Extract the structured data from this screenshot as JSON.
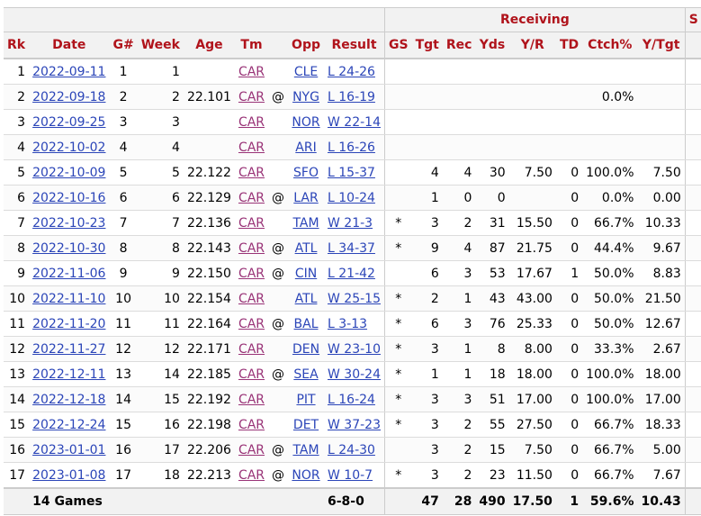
{
  "group_headers": {
    "receiving": "Receiving",
    "next": "S"
  },
  "columns": [
    "Rk",
    "Date",
    "G#",
    "Week",
    "Age",
    "Tm",
    "",
    "Opp",
    "Result",
    "GS",
    "Tgt",
    "Rec",
    "Yds",
    "Y/R",
    "TD",
    "Ctch%",
    "Y/Tgt"
  ],
  "rows": [
    {
      "rk": "1",
      "date": "2022-09-11",
      "g": "1",
      "week": "1",
      "age": "",
      "tm": "CAR",
      "at": "",
      "opp": "CLE",
      "result": "L 24-26",
      "gs": "",
      "tgt": "",
      "rec": "",
      "yds": "",
      "yr": "",
      "td": "",
      "ctch": "",
      "ytgt": ""
    },
    {
      "rk": "2",
      "date": "2022-09-18",
      "g": "2",
      "week": "2",
      "age": "22.101",
      "tm": "CAR",
      "at": "@",
      "opp": "NYG",
      "result": "L 16-19",
      "gs": "",
      "tgt": "",
      "rec": "",
      "yds": "",
      "yr": "",
      "td": "",
      "ctch": "0.0%",
      "ytgt": ""
    },
    {
      "rk": "3",
      "date": "2022-09-25",
      "g": "3",
      "week": "3",
      "age": "",
      "tm": "CAR",
      "at": "",
      "opp": "NOR",
      "result": "W 22-14",
      "gs": "",
      "tgt": "",
      "rec": "",
      "yds": "",
      "yr": "",
      "td": "",
      "ctch": "",
      "ytgt": ""
    },
    {
      "rk": "4",
      "date": "2022-10-02",
      "g": "4",
      "week": "4",
      "age": "",
      "tm": "CAR",
      "at": "",
      "opp": "ARI",
      "result": "L 16-26",
      "gs": "",
      "tgt": "",
      "rec": "",
      "yds": "",
      "yr": "",
      "td": "",
      "ctch": "",
      "ytgt": ""
    },
    {
      "rk": "5",
      "date": "2022-10-09",
      "g": "5",
      "week": "5",
      "age": "22.122",
      "tm": "CAR",
      "at": "",
      "opp": "SFO",
      "result": "L 15-37",
      "gs": "",
      "tgt": "4",
      "rec": "4",
      "yds": "30",
      "yr": "7.50",
      "td": "0",
      "ctch": "100.0%",
      "ytgt": "7.50"
    },
    {
      "rk": "6",
      "date": "2022-10-16",
      "g": "6",
      "week": "6",
      "age": "22.129",
      "tm": "CAR",
      "at": "@",
      "opp": "LAR",
      "result": "L 10-24",
      "gs": "",
      "tgt": "1",
      "rec": "0",
      "yds": "0",
      "yr": "",
      "td": "0",
      "ctch": "0.0%",
      "ytgt": "0.00"
    },
    {
      "rk": "7",
      "date": "2022-10-23",
      "g": "7",
      "week": "7",
      "age": "22.136",
      "tm": "CAR",
      "at": "",
      "opp": "TAM",
      "result": "W 21-3",
      "gs": "*",
      "tgt": "3",
      "rec": "2",
      "yds": "31",
      "yr": "15.50",
      "td": "0",
      "ctch": "66.7%",
      "ytgt": "10.33"
    },
    {
      "rk": "8",
      "date": "2022-10-30",
      "g": "8",
      "week": "8",
      "age": "22.143",
      "tm": "CAR",
      "at": "@",
      "opp": "ATL",
      "result": "L 34-37",
      "gs": "*",
      "tgt": "9",
      "rec": "4",
      "yds": "87",
      "yr": "21.75",
      "td": "0",
      "ctch": "44.4%",
      "ytgt": "9.67"
    },
    {
      "rk": "9",
      "date": "2022-11-06",
      "g": "9",
      "week": "9",
      "age": "22.150",
      "tm": "CAR",
      "at": "@",
      "opp": "CIN",
      "result": "L 21-42",
      "gs": "",
      "tgt": "6",
      "rec": "3",
      "yds": "53",
      "yr": "17.67",
      "td": "1",
      "ctch": "50.0%",
      "ytgt": "8.83"
    },
    {
      "rk": "10",
      "date": "2022-11-10",
      "g": "10",
      "week": "10",
      "age": "22.154",
      "tm": "CAR",
      "at": "",
      "opp": "ATL",
      "result": "W 25-15",
      "gs": "*",
      "tgt": "2",
      "rec": "1",
      "yds": "43",
      "yr": "43.00",
      "td": "0",
      "ctch": "50.0%",
      "ytgt": "21.50"
    },
    {
      "rk": "11",
      "date": "2022-11-20",
      "g": "11",
      "week": "11",
      "age": "22.164",
      "tm": "CAR",
      "at": "@",
      "opp": "BAL",
      "result": "L 3-13",
      "gs": "*",
      "tgt": "6",
      "rec": "3",
      "yds": "76",
      "yr": "25.33",
      "td": "0",
      "ctch": "50.0%",
      "ytgt": "12.67"
    },
    {
      "rk": "12",
      "date": "2022-11-27",
      "g": "12",
      "week": "12",
      "age": "22.171",
      "tm": "CAR",
      "at": "",
      "opp": "DEN",
      "result": "W 23-10",
      "gs": "*",
      "tgt": "3",
      "rec": "1",
      "yds": "8",
      "yr": "8.00",
      "td": "0",
      "ctch": "33.3%",
      "ytgt": "2.67"
    },
    {
      "rk": "13",
      "date": "2022-12-11",
      "g": "13",
      "week": "14",
      "age": "22.185",
      "tm": "CAR",
      "at": "@",
      "opp": "SEA",
      "result": "W 30-24",
      "gs": "*",
      "tgt": "1",
      "rec": "1",
      "yds": "18",
      "yr": "18.00",
      "td": "0",
      "ctch": "100.0%",
      "ytgt": "18.00"
    },
    {
      "rk": "14",
      "date": "2022-12-18",
      "g": "14",
      "week": "15",
      "age": "22.192",
      "tm": "CAR",
      "at": "",
      "opp": "PIT",
      "result": "L 16-24",
      "gs": "*",
      "tgt": "3",
      "rec": "3",
      "yds": "51",
      "yr": "17.00",
      "td": "0",
      "ctch": "100.0%",
      "ytgt": "17.00"
    },
    {
      "rk": "15",
      "date": "2022-12-24",
      "g": "15",
      "week": "16",
      "age": "22.198",
      "tm": "CAR",
      "at": "",
      "opp": "DET",
      "result": "W 37-23",
      "gs": "*",
      "tgt": "3",
      "rec": "2",
      "yds": "55",
      "yr": "27.50",
      "td": "0",
      "ctch": "66.7%",
      "ytgt": "18.33"
    },
    {
      "rk": "16",
      "date": "2023-01-01",
      "g": "16",
      "week": "17",
      "age": "22.206",
      "tm": "CAR",
      "at": "@",
      "opp": "TAM",
      "result": "L 24-30",
      "gs": "",
      "tgt": "3",
      "rec": "2",
      "yds": "15",
      "yr": "7.50",
      "td": "0",
      "ctch": "66.7%",
      "ytgt": "5.00"
    },
    {
      "rk": "17",
      "date": "2023-01-08",
      "g": "17",
      "week": "18",
      "age": "22.213",
      "tm": "CAR",
      "at": "@",
      "opp": "NOR",
      "result": "W 10-7",
      "gs": "*",
      "tgt": "3",
      "rec": "2",
      "yds": "23",
      "yr": "11.50",
      "td": "0",
      "ctch": "66.7%",
      "ytgt": "7.67"
    }
  ],
  "total": {
    "label": "14 Games",
    "result": "6-8-0",
    "tgt": "47",
    "rec": "28",
    "yds": "490",
    "yr": "17.50",
    "td": "1",
    "ctch": "59.6%",
    "ytgt": "10.43"
  }
}
